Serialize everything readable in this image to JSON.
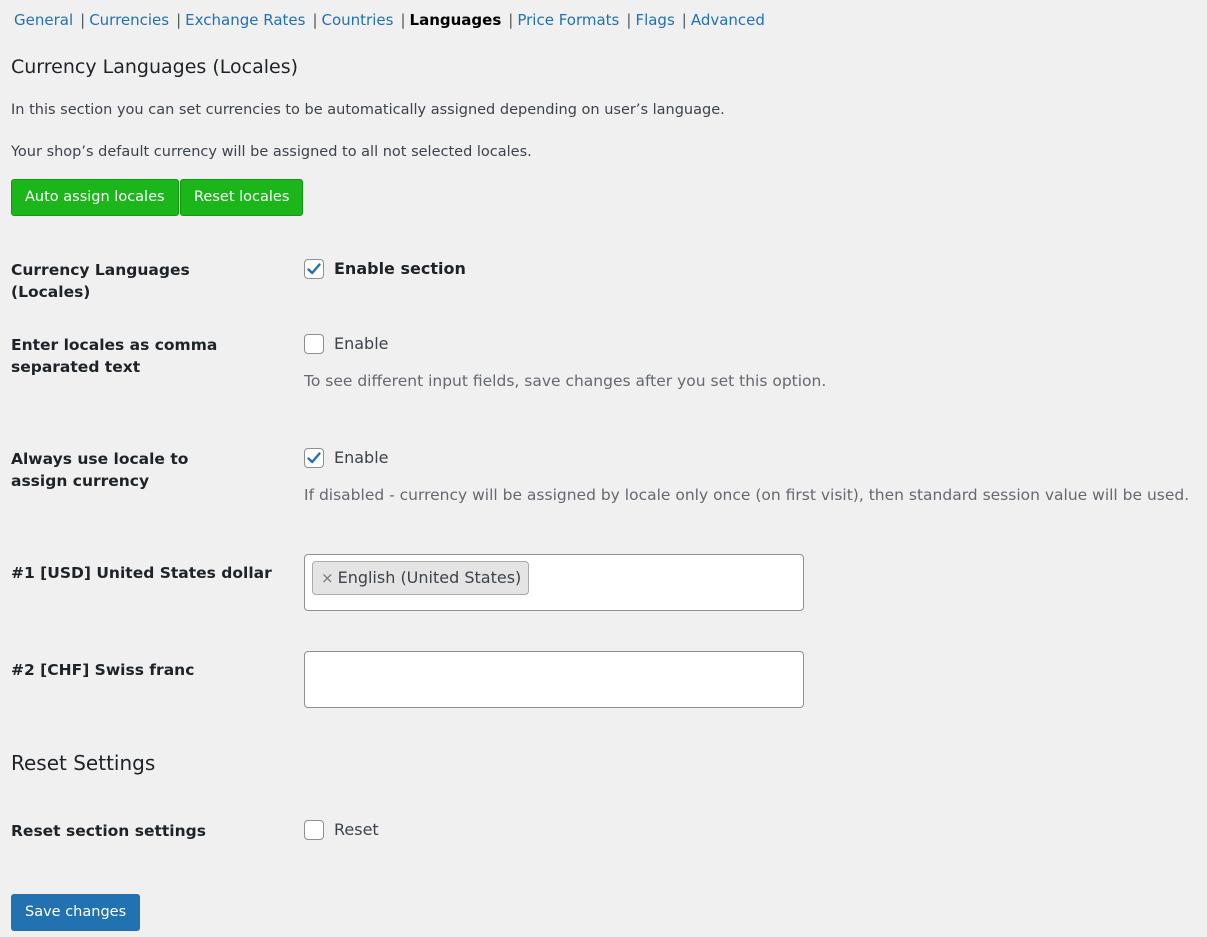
{
  "subnav": {
    "tabs": [
      "General",
      "Currencies",
      "Exchange Rates",
      "Countries",
      "Languages",
      "Price Formats",
      "Flags",
      "Advanced"
    ],
    "current": "Languages",
    "separator": "|"
  },
  "section": {
    "title": "Currency Languages (Locales)",
    "intro": "In this section you can set currencies to be automatically assigned depending on user’s language.",
    "default_note": "Your shop’s default currency will be assigned to all not selected locales.",
    "auto_assign_label": "Auto assign locales",
    "reset_locales_label": "Reset locales"
  },
  "settings": {
    "enable_section": {
      "label": "Currency Languages (Locales)",
      "option": "Enable section",
      "checked": true
    },
    "comma_text": {
      "label": "Enter locales as comma separated text",
      "option": "Enable",
      "checked": false,
      "description": "To see different input fields, save changes after you set this option."
    },
    "always_locale": {
      "label": "Always use locale to assign currency",
      "option": "Enable",
      "checked": true,
      "description": "If disabled - currency will be assigned by locale only once (on first visit), then standard session value will be used."
    },
    "currencies": [
      {
        "label": "#1 [USD] United States dollar",
        "selected": [
          "English (United States)"
        ],
        "remove_glyph": "×"
      },
      {
        "label": "#2 [CHF] Swiss franc",
        "selected": []
      }
    ]
  },
  "reset": {
    "title": "Reset Settings",
    "label": "Reset section settings",
    "option": "Reset",
    "checked": false
  },
  "footer": {
    "save_label": "Save changes"
  },
  "colors": {
    "link": "#2271b1",
    "green_button": "#1ab61a",
    "blue_button": "#2271b1",
    "check": "#2271b1"
  },
  "icons": {
    "checkmark": "checkmark-icon"
  }
}
